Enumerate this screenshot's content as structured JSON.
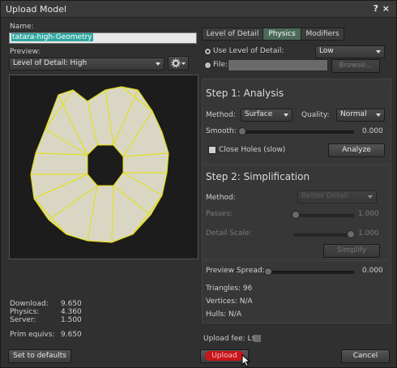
{
  "window": {
    "title": "Upload Model",
    "help": "?",
    "close": "×"
  },
  "left": {
    "name_label": "Name:",
    "name_value": "tatara-high-Geometry",
    "preview_label": "Preview:",
    "preview_select": "Level of Detail: High",
    "stats": {
      "download_label": "Download:",
      "download_value": "9.650",
      "physics_label": "Physics:",
      "physics_value": "4.360",
      "server_label": "Server:",
      "server_value": "1.500",
      "prim_label": "Prim equivs:",
      "prim_value": "9.650"
    },
    "set_defaults": "Set to defaults"
  },
  "tabs": [
    {
      "label": "Level of Detail"
    },
    {
      "label": "Physics"
    },
    {
      "label": "Modifiers"
    }
  ],
  "physics": {
    "use_lod_label": "Use Level of Detail:",
    "use_lod_value": "Low",
    "file_label": "File:",
    "browse": "Browse...",
    "step1_title": "Step 1: Analysis",
    "method_label": "Method:",
    "method_value": "Surface",
    "quality_label": "Quality:",
    "quality_value": "Normal",
    "smooth_label": "Smooth:",
    "smooth_value": "0.000",
    "close_holes": "Close Holes (slow)",
    "analyze": "Analyze",
    "step2_title": "Step 2: Simplification",
    "s2_method_label": "Method:",
    "s2_method_value": "Better Detail",
    "passes_label": "Passes:",
    "passes_value": "1.000",
    "detail_label": "Detail Scale:",
    "detail_value": "1.000",
    "simplify": "Simplify",
    "spread_label": "Preview Spread:",
    "spread_value": "0.000",
    "triangles": "Triangles: 96",
    "vertices": "Vertices: N/A",
    "hulls": "Hulls: N/A"
  },
  "footer": {
    "fee": "Upload fee: L$",
    "upload": "Upload",
    "cancel": "Cancel"
  }
}
